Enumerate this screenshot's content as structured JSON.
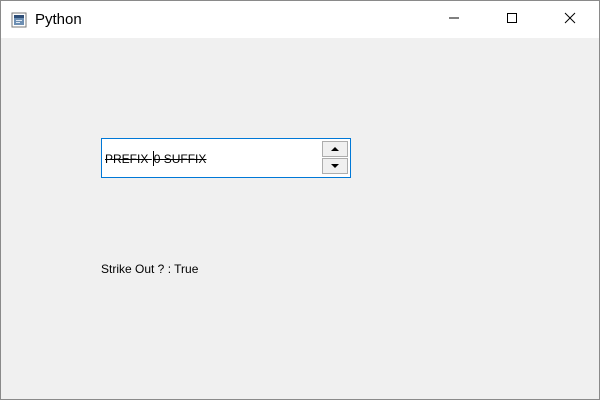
{
  "window": {
    "title": "Python",
    "icons": {
      "app": "python-app-icon",
      "minimize": "minimize-icon",
      "maximize": "maximize-icon",
      "close": "close-icon"
    }
  },
  "spinbox": {
    "prefix": "PREFIX ",
    "value": "0",
    "suffix": " SUFFIX",
    "strike_out": true,
    "icons": {
      "up": "chevron-up-icon",
      "down": "chevron-down-icon"
    }
  },
  "status": {
    "text": "Strike Out ? : True"
  },
  "colors": {
    "accent": "#0078d7",
    "window_bg": "#f0f0f0",
    "titlebar_bg": "#ffffff"
  }
}
